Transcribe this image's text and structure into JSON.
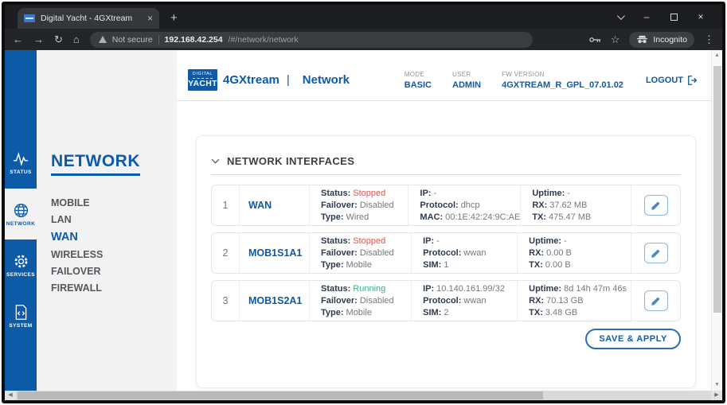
{
  "browser": {
    "tab": {
      "title": "Digital Yacht - 4GXtream",
      "close": "×"
    },
    "new_tab": "+",
    "nav": {
      "back": "←",
      "forward": "→",
      "reload": "↻",
      "home": "⌂"
    },
    "omnibox": {
      "security": "Not secure",
      "host": "192.168.42.254",
      "path": "/#/network/network"
    },
    "actions": {
      "star": "☆",
      "incognito": "Incognito",
      "menu": "⋮"
    },
    "window": {
      "minimize": "–",
      "close": "×"
    }
  },
  "header": {
    "logo": {
      "top": "DIGITAL",
      "bottom": "YACHT"
    },
    "product": "4GXtream",
    "separator": "|",
    "page_title": "Network",
    "meta": [
      {
        "label": "MODE",
        "value": "BASIC"
      },
      {
        "label": "USER",
        "value": "ADMIN"
      },
      {
        "label": "FW VERSION",
        "value": "4GXTREAM_R_GPL_07.01.02"
      }
    ],
    "logout": "LOGOUT"
  },
  "rail": {
    "items": [
      {
        "label": "STATUS"
      },
      {
        "label": "NETWORK"
      },
      {
        "label": "SERVICES"
      },
      {
        "label": "SYSTEM"
      }
    ]
  },
  "sidebar": {
    "title": "NETWORK",
    "items": [
      "MOBILE",
      "LAN",
      "WAN",
      "WIRELESS",
      "FAILOVER",
      "FIREWALL"
    ]
  },
  "content": {
    "section_title": "NETWORK INTERFACES",
    "save_button": "SAVE & APPLY",
    "interfaces": [
      {
        "num": "1",
        "name": "WAN",
        "status": {
          "label": "Status:",
          "value": "Stopped"
        },
        "failover": {
          "label": "Failover:",
          "value": "Disabled"
        },
        "type": {
          "label": "Type:",
          "value": "Wired"
        },
        "ip": {
          "label": "IP:",
          "value": "-"
        },
        "protocol": {
          "label": "Protocol:",
          "value": "dhcp"
        },
        "extra": {
          "label": "MAC:",
          "value": "00:1E:42:24:9C:AE"
        },
        "uptime": {
          "label": "Uptime:",
          "value": "-"
        },
        "rx": {
          "label": "RX:",
          "value": "37.62 MB"
        },
        "tx": {
          "label": "TX:",
          "value": "475.47 MB"
        }
      },
      {
        "num": "2",
        "name": "MOB1S1A1",
        "status": {
          "label": "Status:",
          "value": "Stopped"
        },
        "failover": {
          "label": "Failover:",
          "value": "Disabled"
        },
        "type": {
          "label": "Type:",
          "value": "Mobile"
        },
        "ip": {
          "label": "IP:",
          "value": "-"
        },
        "protocol": {
          "label": "Protocol:",
          "value": "wwan"
        },
        "extra": {
          "label": "SIM:",
          "value": "1"
        },
        "uptime": {
          "label": "Uptime:",
          "value": "-"
        },
        "rx": {
          "label": "RX:",
          "value": "0.00 B"
        },
        "tx": {
          "label": "TX:",
          "value": "0.00 B"
        }
      },
      {
        "num": "3",
        "name": "MOB1S2A1",
        "status": {
          "label": "Status:",
          "value": "Running"
        },
        "failover": {
          "label": "Failover:",
          "value": "Disabled"
        },
        "type": {
          "label": "Type:",
          "value": "Mobile"
        },
        "ip": {
          "label": "IP:",
          "value": "10.140.161.99/32"
        },
        "protocol": {
          "label": "Protocol:",
          "value": "wwan"
        },
        "extra": {
          "label": "SIM:",
          "value": "2"
        },
        "uptime": {
          "label": "Uptime:",
          "value": "8d 14h 47m 46s"
        },
        "rx": {
          "label": "RX:",
          "value": "70.13 GB"
        },
        "tx": {
          "label": "TX:",
          "value": "3.48 GB"
        }
      }
    ]
  },
  "colors": {
    "brand_blue": "#0d5aa7",
    "stopped_red": "#e2574c",
    "running_green": "#3fae85"
  }
}
